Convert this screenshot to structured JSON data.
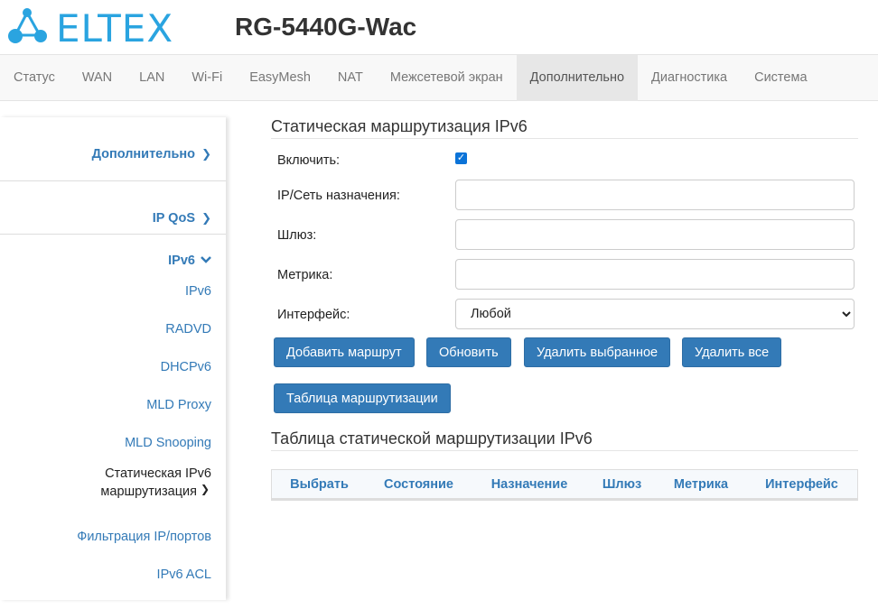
{
  "header": {
    "logo_text": "ELTEX",
    "model": "RG-5440G-Wac"
  },
  "topnav": [
    "Статус",
    "WAN",
    "LAN",
    "Wi-Fi",
    "EasyMesh",
    "NAT",
    "Межсетевой экран",
    "Дополнительно",
    "Диагностика",
    "Система"
  ],
  "topnav_active": "Дополнительно",
  "sidebar": {
    "sections": [
      "Дополнительно",
      "IP QoS",
      "IPv6"
    ],
    "ipv6_items": [
      "IPv6",
      "RADVD",
      "DHCPv6",
      "MLD Proxy",
      "MLD Snooping"
    ],
    "active_item_line1": "Статическая IPv6",
    "active_item_line2": "маршрутизация",
    "after_items": [
      "Фильтрация IP/портов",
      "IPv6 ACL"
    ]
  },
  "form": {
    "title": "Статическая маршрутизация IPv6",
    "enable_label": "Включить:",
    "enable_checked": true,
    "dest_label": "IP/Сеть назначения:",
    "dest_value": "",
    "gateway_label": "Шлюз:",
    "gateway_value": "",
    "metric_label": "Метрика:",
    "metric_value": "",
    "interface_label": "Интерфейс:",
    "interface_value": "Любой"
  },
  "buttons": {
    "add": "Добавить маршрут",
    "refresh": "Обновить",
    "delete_selected": "Удалить выбранное",
    "delete_all": "Удалить все",
    "routing_table": "Таблица маршрутизации"
  },
  "table": {
    "title": "Таблица статической маршрутизации IPv6",
    "columns": [
      "Выбрать",
      "Состояние",
      "Назначение",
      "Шлюз",
      "Метрика",
      "Интерфейс"
    ]
  },
  "colors": {
    "accent": "#337ab7",
    "logo": "#2aa4e0"
  }
}
